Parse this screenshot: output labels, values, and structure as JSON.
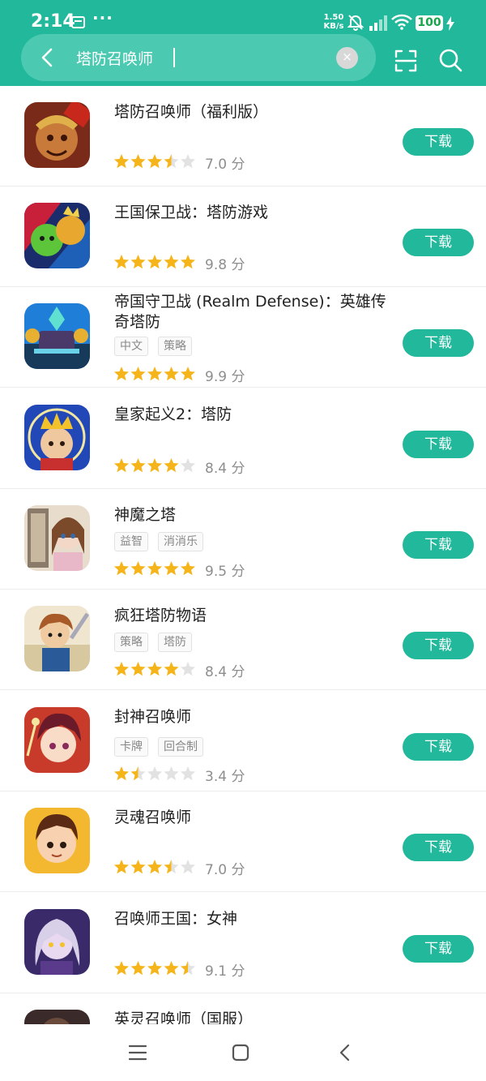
{
  "status_bar": {
    "time": "2:14",
    "dots": "···",
    "net_speed_value": "1.50",
    "net_speed_unit": "KB/s",
    "battery": "100",
    "icons": [
      "message-icon",
      "bell-off-icon",
      "signal-icon",
      "wifi-icon",
      "charging-icon"
    ]
  },
  "search": {
    "query": "塔防召唤师",
    "clear_symbol": "×",
    "icons": [
      "back-icon",
      "clear-icon",
      "scan-icon",
      "search-icon"
    ]
  },
  "colors": {
    "brand": "#22b89b",
    "star": "#f5b51a",
    "star_empty": "#e2e2e2"
  },
  "apps": [
    {
      "name": "塔防召唤师（福利版）",
      "tags": [],
      "rating": 3.5,
      "score": "7.0 分",
      "button": "下载"
    },
    {
      "name": "王国保卫战：塔防游戏",
      "tags": [],
      "rating": 5,
      "score": "9.8 分",
      "button": "下载"
    },
    {
      "name": "帝国守卫战 (Realm Defense)：英雄传奇塔防",
      "tags": [
        "中文",
        "策略"
      ],
      "rating": 5,
      "score": "9.9 分",
      "button": "下载"
    },
    {
      "name": "皇家起义2：塔防",
      "tags": [],
      "rating": 4,
      "score": "8.4 分",
      "button": "下载"
    },
    {
      "name": "神魔之塔",
      "tags": [
        "益智",
        "消消乐"
      ],
      "rating": 5,
      "score": "9.5 分",
      "button": "下载"
    },
    {
      "name": "疯狂塔防物语",
      "tags": [
        "策略",
        "塔防"
      ],
      "rating": 4,
      "score": "8.4 分",
      "button": "下载"
    },
    {
      "name": "封神召唤师",
      "tags": [
        "卡牌",
        "回合制"
      ],
      "rating": 1.5,
      "score": "3.4 分",
      "button": "下载"
    },
    {
      "name": "灵魂召唤师",
      "tags": [],
      "rating": 3.5,
      "score": "7.0 分",
      "button": "下载"
    },
    {
      "name": "召唤师王国：女神",
      "tags": [],
      "rating": 4.5,
      "score": "9.1 分",
      "button": "下载"
    },
    {
      "name": "英灵召唤师（国服）",
      "tags": [],
      "rating": null,
      "score": "",
      "button": ""
    }
  ],
  "nav": {
    "icons": [
      "menu-icon",
      "home-icon",
      "back-icon"
    ]
  }
}
